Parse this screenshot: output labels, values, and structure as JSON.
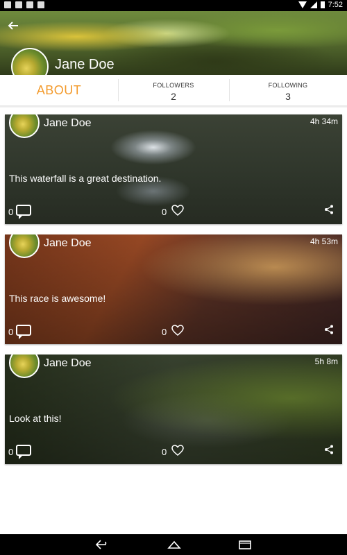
{
  "status_bar": {
    "time": "7:52"
  },
  "header": {
    "name": "Jane Doe"
  },
  "tabs": {
    "about_label": "ABOUT",
    "followers_label": "FOLLOWERS",
    "followers_count": "2",
    "following_label": "FOLLOWING",
    "following_count": "3"
  },
  "posts": [
    {
      "author": "Jane Doe",
      "time": "4h 34m",
      "text": "This waterfall is a great destination.",
      "comments": "0",
      "likes": "0"
    },
    {
      "author": "Jane Doe",
      "time": "4h 53m",
      "text": "This race is awesome!",
      "comments": "0",
      "likes": "0"
    },
    {
      "author": "Jane Doe",
      "time": "5h 8m",
      "text": "Look at this!",
      "comments": "0",
      "likes": "0"
    }
  ],
  "colors": {
    "accent": "#f39a2b",
    "header_green": "#5a7131",
    "status_bar": "#000000"
  },
  "icons": {
    "back": "arrow-left-icon",
    "comment": "comment-bubble-icon",
    "like": "heart-outline-icon",
    "share": "share-icon",
    "nav_back": "back-arrow-icon",
    "nav_home": "home-icon",
    "nav_recents": "recents-icon"
  }
}
